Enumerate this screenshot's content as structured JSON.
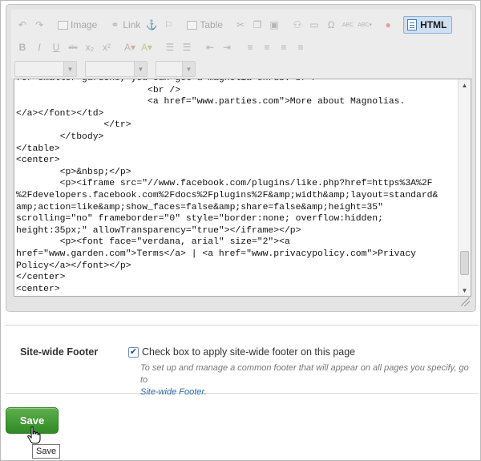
{
  "editor": {
    "toolbar": {
      "image_label": "Image",
      "link_label": "Link",
      "table_label": "Table",
      "html_label": "HTML",
      "icons": [
        "undo-icon",
        "redo-icon",
        "image-icon",
        "link-icon",
        "anchor-icon",
        "flag-icon",
        "table-icon",
        "cut-icon",
        "copy-icon",
        "paste-icon",
        "find-icon",
        "horizontal-rule-icon",
        "special-char-icon",
        "spellcheck-icon",
        "spellcheck-dropdown-icon",
        "flash-icon",
        "html-source-icon",
        "bold-icon",
        "italic-icon",
        "underline-icon",
        "strikethrough-icon",
        "subscript-icon",
        "superscript-icon",
        "text-color-icon",
        "bg-color-icon",
        "numbered-list-icon",
        "bulleted-list-icon",
        "outdent-icon",
        "indent-icon",
        "align-left-icon",
        "align-center-icon",
        "align-right-icon",
        "justify-icon"
      ]
    },
    "code_lines": [
      "for smaller gardens, you can get a magnolia shrub.<br />",
      "                        <br />",
      "                        <a href=\"www.parties.com\">More about Magnolias.",
      "</a></font></td>",
      "                </tr>",
      "        </tbody>",
      "</table>",
      "<center>",
      "        <p>&nbsp;</p>",
      "        <p><iframe src=\"//www.facebook.com/plugins/like.php?href=https%3A%2F",
      "%2Fdevelopers.facebook.com%2Fdocs%2Fplugins%2F&amp;width&amp;layout=standard&",
      "amp;action=like&amp;show_faces=false&amp;share=false&amp;height=35\"",
      "scrolling=\"no\" frameborder=\"0\" style=\"border:none; overflow:hidden;",
      "height:35px;\" allowTransparency=\"true\"></iframe></p>",
      "        <p><font face=\"verdana, arial\" size=\"2\"><a",
      "href=\"www.garden.com\">Terms</a> | <a href=\"www.privacypolicy.com\">Privacy",
      "Policy</a></font></p>",
      "</center>",
      "<center>"
    ]
  },
  "footer_section": {
    "label": "Site-wide Footer",
    "checkbox_checked": true,
    "checkbox_label": "Check box to apply site-wide footer on this page",
    "help_text": "To set up and manage a common footer that will appear on all pages you specify, go to",
    "help_link": "Site-wide Footer",
    "help_suffix": "."
  },
  "save": {
    "label": "Save",
    "tooltip": "Save"
  },
  "colors": {
    "save_green": "#3b9530",
    "link_blue": "#2e6ab1",
    "html_button_bg": "#cfe0f2"
  }
}
